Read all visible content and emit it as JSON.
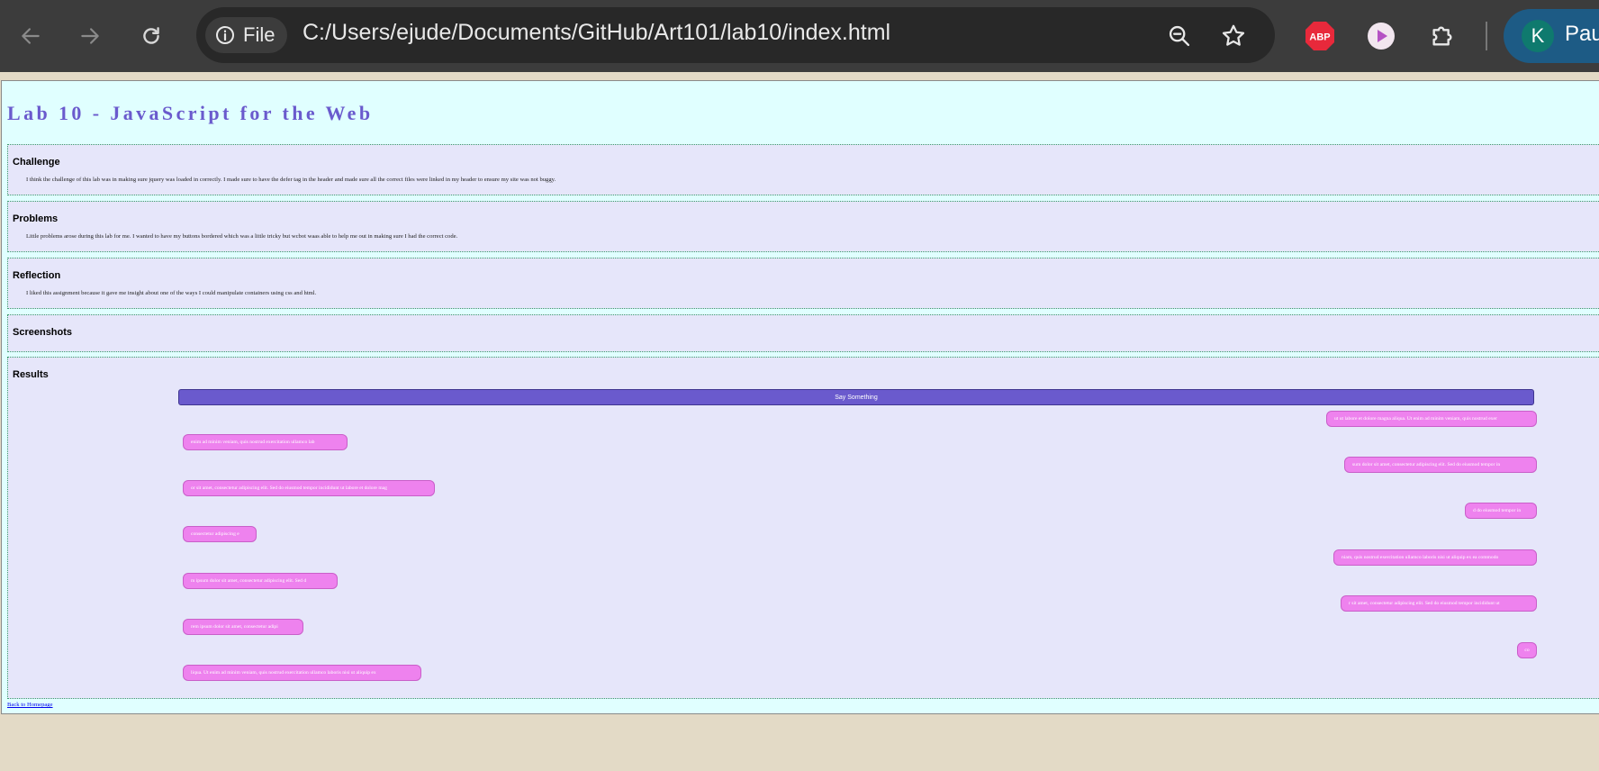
{
  "browser": {
    "site_chip_label": "File",
    "url": "C:/Users/ejude/Documents/GitHub/Art101/lab10/index.html",
    "profile_initial": "K",
    "profile_label": "Paus",
    "extensions": [
      "adblock-plus-icon",
      "media-player-icon",
      "puzzle-extensions-icon"
    ],
    "abp_label": "ABP"
  },
  "page": {
    "title": "Lab 10 - JavaScript for the Web",
    "sections": [
      {
        "title": "Challenge",
        "text": "I think the challenge of this lab was in making sure jquery was loaded in correctly. I made sure to have the defer tag in the header and made sure all the correct files were linked in my header to ensure my site was not buggy."
      },
      {
        "title": "Problems",
        "text": "Little problems arose during this lab for me. I wanted to have my buttons bordered which was a little tricky but wcbot waas able to help me out in making sure I had the correct code."
      },
      {
        "title": "Reflection",
        "text": "I liked this assignment because it gave me insight about one of the ways I could manipulate containers using css and html."
      },
      {
        "title": "Screenshots",
        "text": ""
      },
      {
        "title": "Results",
        "text": ""
      }
    ],
    "say_button_label": "Say Something",
    "bubbles": [
      {
        "text": "ut ut labore et dolore magna aliqua. Ut enim ad minim veniam, quis nostrud exer",
        "side": "right"
      },
      {
        "text": "enim ad minim veniam, quis nostrud exercitation ullamco lab",
        "side": "left"
      },
      {
        "text": "sum dolor sit amet, consectetur adipiscing elit. Sed do eiusmod tempor in",
        "side": "right"
      },
      {
        "text": "or sit amet, consectetur adipiscing elit. Sed do eiusmod tempor incididunt ut labore et dolore mag",
        "side": "left"
      },
      {
        "text": "d do eiusmod tempor in",
        "side": "right"
      },
      {
        "text": "consectetur adipiscing e",
        "side": "left"
      },
      {
        "text": "niam, quis nostrud exercitation ullamco laboris nisi ut aliquip ex ea commodo",
        "side": "right"
      },
      {
        "text": "m ipsum dolor sit amet, consectetur adipiscing elit. Sed d",
        "side": "left"
      },
      {
        "text": "r sit amet, consectetur adipiscing elit. Sed do eiusmod tempor incididunt ut",
        "side": "right"
      },
      {
        "text": "rem ipsum dolor sit amet, consectetur adipi",
        "side": "left"
      },
      {
        "text": "co",
        "side": "right"
      },
      {
        "text": "liqua. Ut enim ad minim veniam, quis nostrud exercitation ullamco laboris nisi ut aliquip ex",
        "side": "left"
      }
    ],
    "back_link": "Back to Homepage"
  },
  "colors": {
    "title": "#6a5acd",
    "button": "#6a5acd",
    "bubble": "#ee82ee",
    "page_bg": "#e0ffff",
    "section_bg": "#e6e6fa"
  }
}
